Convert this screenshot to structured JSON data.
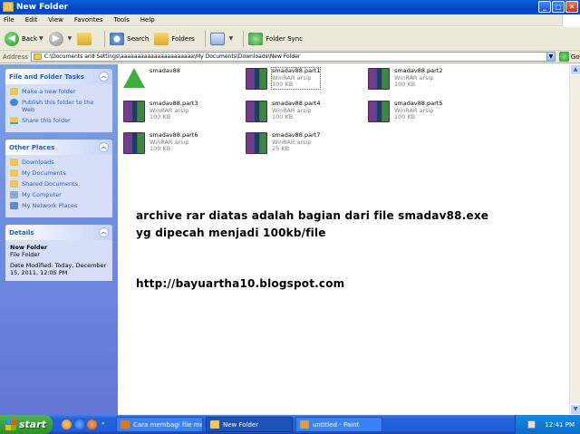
{
  "window": {
    "title": "New Folder"
  },
  "menu": [
    "File",
    "Edit",
    "View",
    "Favorites",
    "Tools",
    "Help"
  ],
  "toolbar": {
    "back": "Back",
    "search": "Search",
    "folders": "Folders",
    "folder_sync": "Folder Sync"
  },
  "address": {
    "label": "Address",
    "path": "C:\\Documents and Settings\\aaaaaaaaaaaaaaaaaaaaaa\\My Documents\\Downloads\\New Folder",
    "go": "Go"
  },
  "panels": {
    "tasks": {
      "title": "File and Folder Tasks",
      "items": [
        "Make a new folder",
        "Publish this folder to the Web",
        "Share this folder"
      ]
    },
    "places": {
      "title": "Other Places",
      "items": [
        "Downloads",
        "My Documents",
        "Shared Documents",
        "My Computer",
        "My Network Places"
      ]
    },
    "details": {
      "title": "Details",
      "name": "New Folder",
      "type": "File Folder",
      "modified": "Date Modified: Today, December 15, 2011, 12:05 PM"
    }
  },
  "files": [
    {
      "name": "smadav88",
      "type": "",
      "size": "",
      "icon": "smadav-icon"
    },
    {
      "name": "smadav88.part1",
      "type": "WinRAR arsip",
      "size": "100 KB",
      "icon": "winrar-icon",
      "selected": true
    },
    {
      "name": "smadav88.part2",
      "type": "WinRAR arsip",
      "size": "100 KB",
      "icon": "winrar-icon"
    },
    {
      "name": "smadav88.part3",
      "type": "WinRAR arsip",
      "size": "100 KB",
      "icon": "winrar-icon"
    },
    {
      "name": "smadav88.part4",
      "type": "WinRAR arsip",
      "size": "100 KB",
      "icon": "winrar-icon"
    },
    {
      "name": "smadav88.part5",
      "type": "WinRAR arsip",
      "size": "100 KB",
      "icon": "winrar-icon"
    },
    {
      "name": "smadav88.part6",
      "type": "WinRAR arsip",
      "size": "100 KB",
      "icon": "winrar-icon"
    },
    {
      "name": "smadav88.part7",
      "type": "WinRAR arsip",
      "size": "25 KB",
      "icon": "winrar-icon"
    }
  ],
  "note": {
    "line1": "archive rar diatas adalah bagian dari file smadav88.exe",
    "line2": "yg dipecah menjadi 100kb/file",
    "url": "http://bayuartha10.blogspot.com"
  },
  "taskbar": {
    "start": "start",
    "tasks": [
      "Cara membagi file me...",
      "New Folder",
      "untitled - Paint"
    ],
    "clock": "12:41 PM"
  }
}
